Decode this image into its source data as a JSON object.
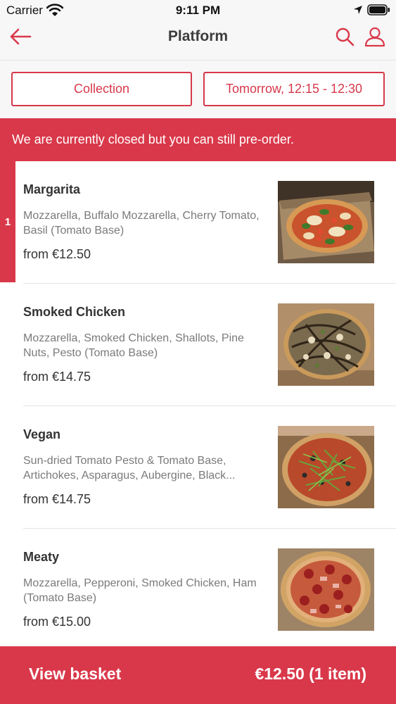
{
  "status_bar": {
    "carrier": "Carrier",
    "time": "9:11 PM",
    "icons": [
      "wifi-icon",
      "location-icon",
      "battery-icon"
    ]
  },
  "nav": {
    "title": "Platform",
    "icons": [
      "back-arrow-icon",
      "search-icon",
      "user-icon"
    ]
  },
  "options": {
    "collection_label": "Collection",
    "time_label": "Tomorrow, 12:15 - 12:30"
  },
  "banner": {
    "text": "We are currently closed but you can still pre-order."
  },
  "menu": {
    "items": [
      {
        "name": "Margarita",
        "description": "Mozzarella, Buffalo Mozzarella, Cherry Tomato, Basil (Tomato Base)",
        "price": "from €12.50",
        "quantity": "1"
      },
      {
        "name": "Smoked Chicken",
        "description": "Mozzarella, Smoked Chicken, Shallots, Pine Nuts, Pesto (Tomato Base)",
        "price": "from €14.75"
      },
      {
        "name": "Vegan",
        "description": "Sun-dried Tomato Pesto & Tomato Base, Artichokes, Asparagus, Aubergine, Black...",
        "price": "from €14.75"
      },
      {
        "name": "Meaty",
        "description": "Mozzarella, Pepperoni, Smoked Chicken, Ham (Tomato Base)",
        "price": "from €15.00"
      }
    ]
  },
  "basket": {
    "label": "View basket",
    "total": "€12.50 (1 item)"
  },
  "colors": {
    "accent": "#d9384a",
    "background": "#f7f7f7",
    "text": "#333333",
    "muted_text": "#7a7a7a"
  }
}
